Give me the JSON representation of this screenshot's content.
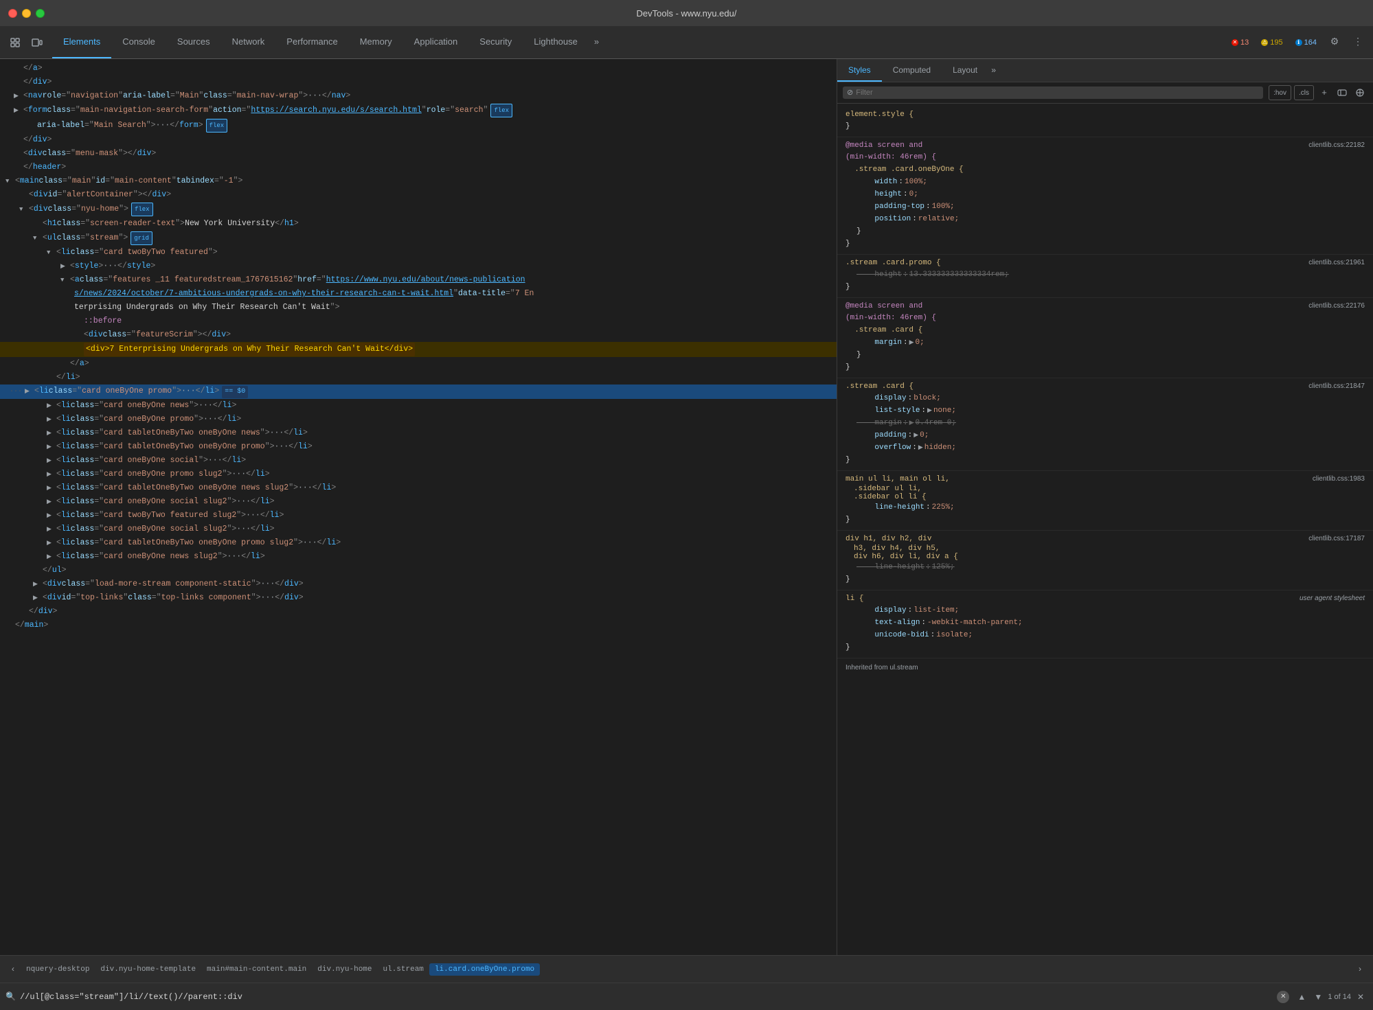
{
  "titleBar": {
    "title": "DevTools - www.nyu.edu/"
  },
  "tabs": [
    {
      "id": "elements",
      "label": "Elements",
      "active": true
    },
    {
      "id": "console",
      "label": "Console",
      "active": false
    },
    {
      "id": "sources",
      "label": "Sources",
      "active": false
    },
    {
      "id": "network",
      "label": "Network",
      "active": false
    },
    {
      "id": "performance",
      "label": "Performance",
      "active": false
    },
    {
      "id": "memory",
      "label": "Memory",
      "active": false
    },
    {
      "id": "application",
      "label": "Application",
      "active": false
    },
    {
      "id": "security",
      "label": "Security",
      "active": false
    },
    {
      "id": "lighthouse",
      "label": "Lighthouse",
      "active": false
    }
  ],
  "errors": {
    "red": "13",
    "yellow": "195",
    "blue": "164"
  },
  "subtabs": [
    {
      "id": "styles",
      "label": "Styles",
      "active": true
    },
    {
      "id": "computed",
      "label": "Computed",
      "active": false
    },
    {
      "id": "layout",
      "label": "Layout",
      "active": false
    }
  ],
  "filter": {
    "placeholder": "Filter",
    "hov_label": ":hov",
    "cls_label": ".cls"
  },
  "domContent": [
    {
      "indent": 0,
      "type": "close",
      "text": "</a>"
    },
    {
      "indent": 0,
      "type": "close",
      "text": "</div>"
    },
    {
      "indent": 0,
      "type": "open-tag",
      "text": "<nav role=\"navigation\" aria-label=\"Main\" class=\"main-nav-wrap\">",
      "hasEllipsis": true,
      "closeSuffix": "</nav>",
      "expanded": true
    },
    {
      "indent": 0,
      "type": "open-tag",
      "text": "<form class=\"main-navigation-search-form\" action=\"https://search.nyu.edu/s/search.html\" role=\"search\"",
      "hasEllipsis": true,
      "hasFlex": true,
      "expanded": true
    },
    {
      "indent": 1,
      "type": "text",
      "text": "aria-label=\"Main Search\">",
      "hasEllipsis": true,
      "closeSuffix": "</form>"
    },
    {
      "indent": 0,
      "type": "close",
      "text": "</div>"
    },
    {
      "indent": 0,
      "type": "tag",
      "text": "<div class=\"menu-mask\"></div>"
    },
    {
      "indent": 0,
      "type": "close",
      "text": "</header>"
    },
    {
      "indent": 0,
      "type": "open-main",
      "text": "<main class=\"main\" id=\"main-content\" tabindex=\"-1\">",
      "expanded": true
    },
    {
      "indent": 1,
      "type": "tag",
      "text": "<div id=\"alertContainer\"></div>"
    },
    {
      "indent": 1,
      "type": "open-tag",
      "text": "<div class=\"nyu-home\">",
      "hasFlex": true,
      "expanded": true
    },
    {
      "indent": 2,
      "type": "tag",
      "text": "<h1 class=\"screen-reader-text\">New York University</h1>"
    },
    {
      "indent": 2,
      "type": "open-tag",
      "text": "<ul class=\"stream\">",
      "hasGrid": true,
      "expanded": true
    },
    {
      "indent": 3,
      "type": "open-tag",
      "text": "<li class=\"card twoByTwo featured\">",
      "expanded": true
    },
    {
      "indent": 4,
      "type": "open-tag",
      "text": "<style>",
      "hasEllipsis": true,
      "closeSuffix": "</style>",
      "expanded": false,
      "collapsed": true
    },
    {
      "indent": 4,
      "type": "open-tag",
      "text": "<a class=\"features _11 featuredstream_1767615162\" href=\"https://www.nyu.edu/about/news-publications/news/2024/october/7-ambitious-undergrads-on-why-their-research-can-t-wait.html\" data-title=\"7 Enterprising Undergrads on Why Their Research Can't Wait\">",
      "expanded": true,
      "multiline": true
    },
    {
      "indent": 5,
      "type": "pseudo",
      "text": "::before"
    },
    {
      "indent": 5,
      "type": "tag",
      "text": "<div class=\"featureScrim\"></div>"
    },
    {
      "indent": 5,
      "type": "text-highlight",
      "text": "<div>7 Enterprising Undergrads on Why Their Research Can't Wait</div>"
    },
    {
      "indent": 4,
      "type": "close",
      "text": "</a>"
    },
    {
      "indent": 3,
      "type": "close",
      "text": "</li>"
    },
    {
      "indent": 3,
      "type": "selected-tag",
      "text": "<li class=\"card oneByOne promo\">",
      "hasEllipsis": true,
      "closeSuffix": "</li>",
      "hasDollar": true
    },
    {
      "indent": 3,
      "type": "open-tag",
      "text": "<li class=\"card oneByOne news\">",
      "hasEllipsis": true,
      "closeSuffix": "</li>",
      "collapsed": true
    },
    {
      "indent": 3,
      "type": "open-tag",
      "text": "<li class=\"card oneByOne promo\">",
      "hasEllipsis": true,
      "closeSuffix": "</li>",
      "collapsed": true
    },
    {
      "indent": 3,
      "type": "open-tag",
      "text": "<li class=\"card tabletOneByTwo oneByOne news\">",
      "hasEllipsis": true,
      "closeSuffix": "</li>",
      "collapsed": true
    },
    {
      "indent": 3,
      "type": "open-tag",
      "text": "<li class=\"card tabletOneByTwo oneByOne promo\">",
      "hasEllipsis": true,
      "closeSuffix": "</li>",
      "collapsed": true
    },
    {
      "indent": 3,
      "type": "open-tag",
      "text": "<li class=\"card oneByOne social\">",
      "hasEllipsis": true,
      "closeSuffix": "</li>",
      "collapsed": true
    },
    {
      "indent": 3,
      "type": "open-tag",
      "text": "<li class=\"card oneByOne promo slug2\">",
      "hasEllipsis": true,
      "closeSuffix": "</li>",
      "collapsed": true
    },
    {
      "indent": 3,
      "type": "open-tag",
      "text": "<li class=\"card tabletOneByTwo oneByOne news slug2\">",
      "hasEllipsis": true,
      "closeSuffix": "</li>",
      "collapsed": true
    },
    {
      "indent": 3,
      "type": "open-tag",
      "text": "<li class=\"card oneByOne social slug2\">",
      "hasEllipsis": true,
      "closeSuffix": "</li>",
      "collapsed": true
    },
    {
      "indent": 3,
      "type": "open-tag",
      "text": "<li class=\"card twoByTwo featured slug2\">",
      "hasEllipsis": true,
      "closeSuffix": "</li>",
      "collapsed": true
    },
    {
      "indent": 3,
      "type": "open-tag",
      "text": "<li class=\"card oneByOne social slug2\">",
      "hasEllipsis": true,
      "closeSuffix": "</li>",
      "collapsed": true
    },
    {
      "indent": 3,
      "type": "open-tag",
      "text": "<li class=\"card tabletOneByTwo oneByOne promo slug2\">",
      "hasEllipsis": true,
      "closeSuffix": "</li>",
      "collapsed": true
    },
    {
      "indent": 3,
      "type": "open-tag",
      "text": "<li class=\"card oneByOne news slug2\">",
      "hasEllipsis": true,
      "closeSuffix": "</li>",
      "collapsed": true
    },
    {
      "indent": 2,
      "type": "close",
      "text": "</ul>"
    },
    {
      "indent": 2,
      "type": "open-tag",
      "text": "<div class=\"load-more-stream component-static\">",
      "hasEllipsis": true,
      "closeSuffix": "</div>",
      "collapsed": true
    },
    {
      "indent": 2,
      "type": "open-tag",
      "text": "<div id=\"top-links\" class=\"top-links component\">",
      "hasEllipsis": true,
      "closeSuffix": "</div>",
      "collapsed": true
    },
    {
      "indent": 1,
      "type": "close",
      "text": "</div>"
    },
    {
      "indent": 0,
      "type": "close",
      "text": "</main>"
    }
  ],
  "styleRules": [
    {
      "selector": "element.style {",
      "source": "",
      "properties": [],
      "closeBrace": "}"
    },
    {
      "selector": "@media screen and (min-width: 46rem) {",
      "source": "clientlib.css:22182",
      "innerSelector": ".stream .card.oneByOne {",
      "properties": [
        {
          "name": "width",
          "value": "100%;",
          "strikethrough": false
        },
        {
          "name": "height",
          "value": "0;",
          "strikethrough": false
        },
        {
          "name": "padding-top",
          "value": "100%;",
          "strikethrough": false
        },
        {
          "name": "position",
          "value": "relative;",
          "strikethrough": false
        }
      ],
      "closeBrace": "}"
    },
    {
      "selector": ".stream .card.promo {",
      "source": "clientlib.css:21961",
      "properties": [
        {
          "name": "height",
          "value": "13.333333333333334rem;",
          "strikethrough": true
        }
      ],
      "closeBrace": "}"
    },
    {
      "selector": "@media screen and (min-width: 46rem) {",
      "source": "clientlib.css:22176",
      "innerSelector": ".stream .card {",
      "properties": [
        {
          "name": "margin",
          "value": "▶ 0;",
          "hasArrow": true,
          "strikethrough": false
        }
      ],
      "closeBrace": "}"
    },
    {
      "selector": ".stream .card {",
      "source": "clientlib.css:21847",
      "properties": [
        {
          "name": "display",
          "value": "block;",
          "strikethrough": false
        },
        {
          "name": "list-style",
          "value": "▶ none;",
          "hasArrow": true,
          "strikethrough": false
        },
        {
          "name": "margin",
          "value": "▶ 0.4rem 0;",
          "hasArrow": true,
          "strikethrough": true
        },
        {
          "name": "padding",
          "value": "▶ 0;",
          "hasArrow": true,
          "strikethrough": false
        },
        {
          "name": "overflow",
          "value": "▶ hidden;",
          "hasArrow": true,
          "strikethrough": false
        }
      ],
      "closeBrace": "}"
    },
    {
      "selector": "main ul li, main ol li,\n.sidebar ul li,\n.sidebar ol li {",
      "source": "clientlib.css:1983",
      "properties": [
        {
          "name": "line-height",
          "value": "225%;",
          "strikethrough": false
        }
      ],
      "closeBrace": "}"
    },
    {
      "selector": "div h1, div h2, div\nh3, div h4, div h5,\ndiv h6, div li, div a {",
      "source": "clientlib.css:17187",
      "properties": [
        {
          "name": "line-height",
          "value": "125%;",
          "strikethrough": true
        }
      ],
      "closeBrace": "}"
    },
    {
      "selector": "li {",
      "source": "user agent stylesheet",
      "isUserAgent": true,
      "properties": [
        {
          "name": "display",
          "value": "list-item;",
          "strikethrough": false
        },
        {
          "name": "text-align",
          "value": "-webkit-match-parent;",
          "strikethrough": false
        },
        {
          "name": "unicode-bidi",
          "value": "isolate;",
          "strikethrough": false
        }
      ],
      "closeBrace": "}"
    }
  ],
  "inheritedLabel": "Inherited from ul.stream",
  "breadcrumbs": [
    {
      "id": "nquery-desktop",
      "label": "nquery-desktop"
    },
    {
      "id": "div-nyu-home-template",
      "label": "div.nyu-home-template"
    },
    {
      "id": "main-main-content",
      "label": "main#main-content.main"
    },
    {
      "id": "div-nyu-home",
      "label": "div.nyu-home"
    },
    {
      "id": "ul-stream",
      "label": "ul.stream"
    },
    {
      "id": "li-card-oneByOne-promo",
      "label": "li.card.oneByOne.promo",
      "active": true
    }
  ],
  "searchBar": {
    "query": "//ul[@class=\"stream\"]/li//text()//parent::div",
    "count": "1 of 14"
  }
}
